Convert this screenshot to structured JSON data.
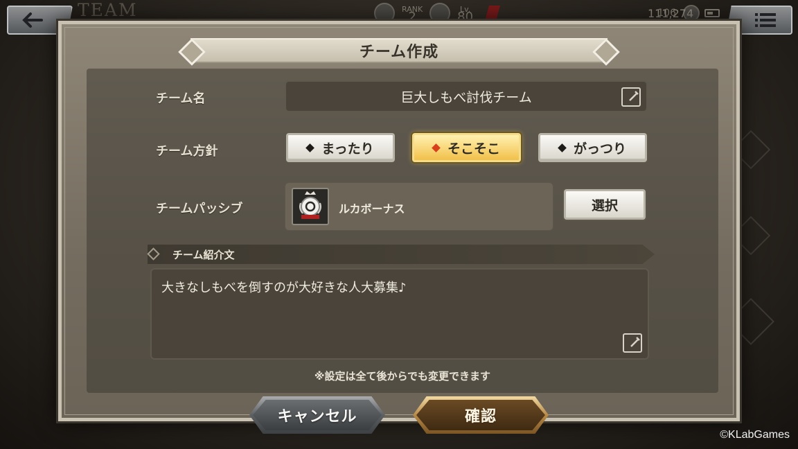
{
  "hud": {
    "screen_title": "TEAM",
    "rank_label": "RANK",
    "rank_value": "2",
    "level_label": "Lv.",
    "level_value": "80",
    "stamina": "106",
    "gold": "111,274"
  },
  "dialog": {
    "title": "チーム作成",
    "team_name_label": "チーム名",
    "team_name_value": "巨大しもべ討伐チーム",
    "policy_label": "チーム方針",
    "policy_options": [
      {
        "label": "まったり",
        "selected": false
      },
      {
        "label": "そこそこ",
        "selected": true
      },
      {
        "label": "がっつり",
        "selected": false
      }
    ],
    "passive_label": "チームパッシブ",
    "passive_name": "ルカボーナス",
    "select_button": "選択",
    "intro_label": "チーム紹介文",
    "intro_text": "大きなしもべを倒すのが大好きな人大募集♪",
    "note": "※設定は全て後からでも変更できます"
  },
  "buttons": {
    "cancel": "キャンセル",
    "confirm": "確認"
  },
  "copyright": "©KLabGames",
  "colors": {
    "selected_policy": "#f2c04a",
    "dialog_bg": "#7d7568",
    "field_bg": "#4a443a"
  },
  "icons": [
    "back-arrow-icon",
    "menu-icon",
    "edit-icon",
    "passive-emblem-icon"
  ]
}
